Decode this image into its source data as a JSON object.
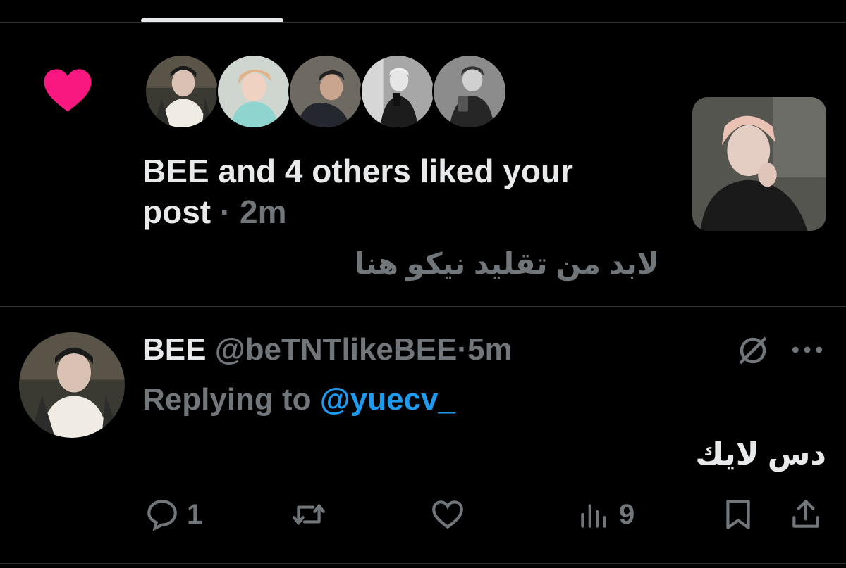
{
  "notification": {
    "heart_color": "#f91880",
    "text_main": "BEE and 4 others liked your post",
    "separator": "·",
    "time": "2m",
    "quoted_text": "لابد من تقليد نيكو هنا",
    "avatars": [
      "avatar-bee",
      "avatar-user-2",
      "avatar-user-3",
      "avatar-user-4",
      "avatar-user-5"
    ]
  },
  "reply": {
    "display_name": "BEE",
    "handle": "@beTNTlikeBEE",
    "separator": "·",
    "time": "5m",
    "replying_prefix": "Replying to",
    "replying_mention": "@yuecv_",
    "body": "دس لايك",
    "actions": {
      "reply_count": "1",
      "retweet_count": "",
      "like_count": "",
      "views_count": "9"
    }
  },
  "colors": {
    "background": "#000000",
    "text_primary": "#e7e9ea",
    "text_secondary": "#71767b",
    "accent": "#1d9bf0",
    "like": "#f91880",
    "divider": "#2f3336"
  }
}
